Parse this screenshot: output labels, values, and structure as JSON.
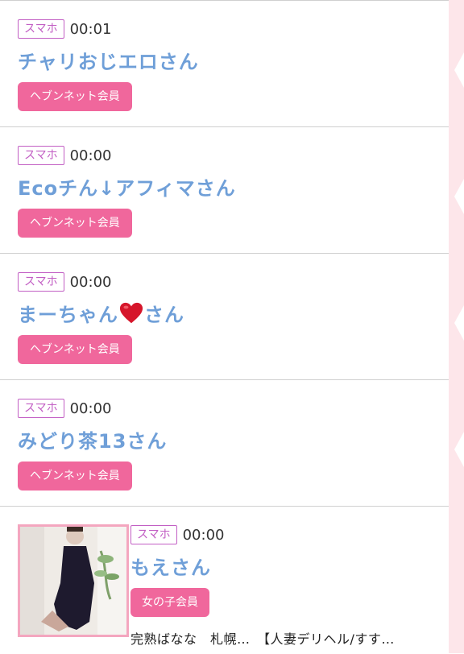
{
  "colors": {
    "accent_pink": "#f0679c",
    "device_purple": "#c25fc4",
    "name_blue": "#6f9fd8",
    "side_strip": "#fde6ea",
    "thumb_border": "#f4a6bf"
  },
  "entries": [
    {
      "device": "スマホ",
      "time": "00:01",
      "name": "チャリおじエロさん",
      "member_label": "ヘブンネット会員"
    },
    {
      "device": "スマホ",
      "time": "00:00",
      "name": "Ecoチん↓アフィマさん",
      "member_label": "ヘブンネット会員"
    },
    {
      "device": "スマホ",
      "time": "00:00",
      "name_before": "まーちゃん",
      "name_icon": "heart-icon",
      "name_after": "さん",
      "member_label": "ヘブンネット会員"
    },
    {
      "device": "スマホ",
      "time": "00:00",
      "name": "みどり茶13さん",
      "member_label": "ヘブンネット会員"
    }
  ],
  "girl_entry": {
    "device": "スマホ",
    "time": "00:00",
    "name": "もえさん",
    "member_label": "女の子会員",
    "shop_text": "完熟ばなな　札幌…　【人妻デリヘル/すす…",
    "photo_icon": "profile-photo"
  }
}
